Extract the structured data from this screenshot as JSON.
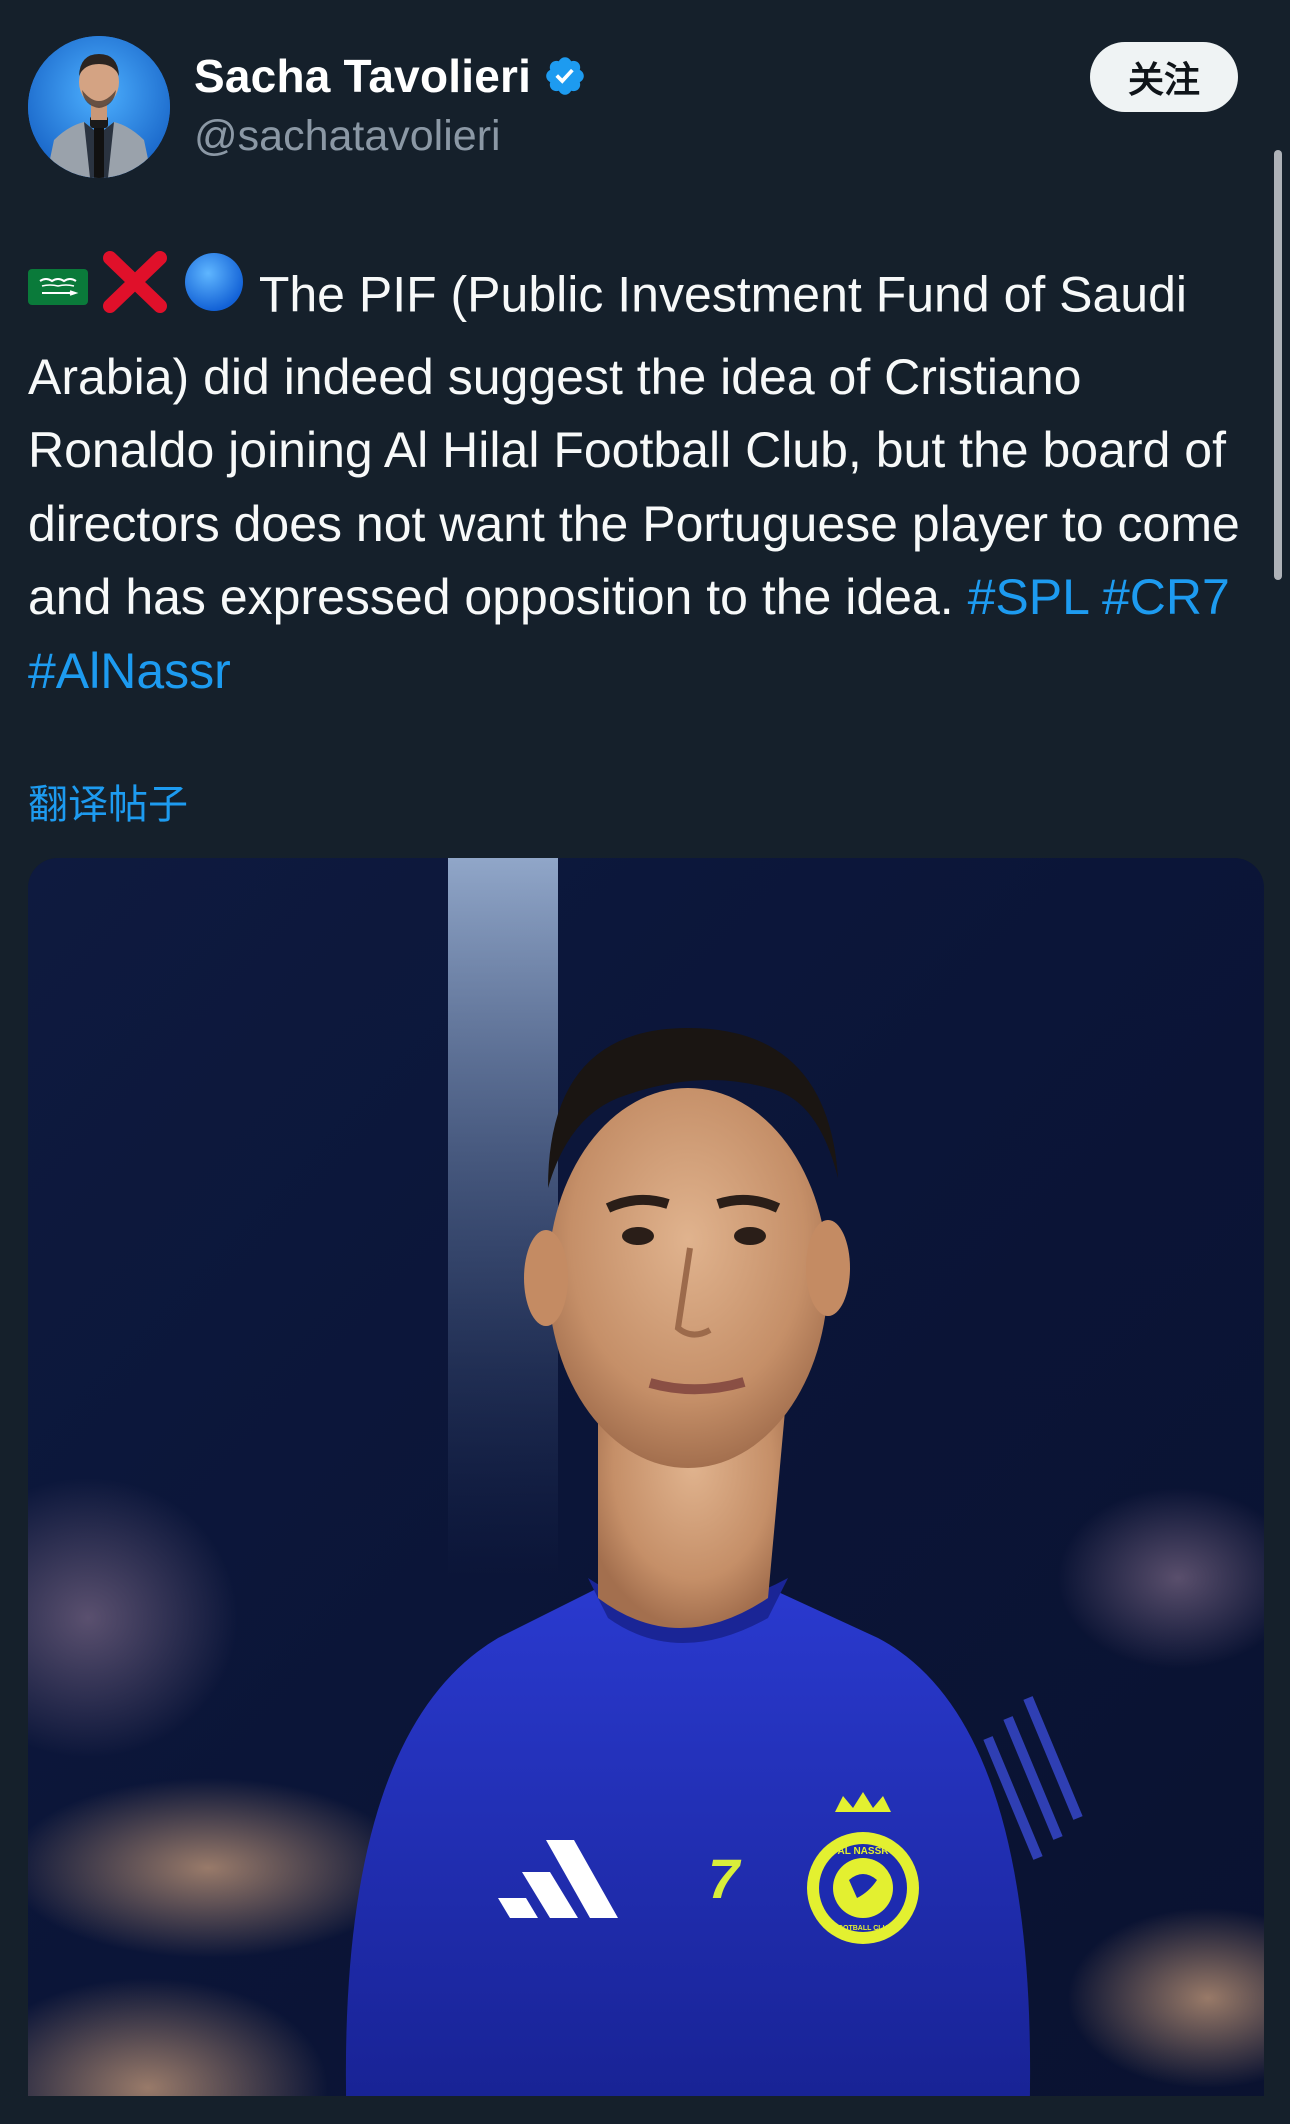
{
  "tweet": {
    "author": {
      "name": "Sacha Tavolieri",
      "handle": "@sachatavolieri",
      "verified": true
    },
    "follow_label": "关注",
    "text_lead": "The PIF (Public Investment Fund of Saudi Arabia) did indeed suggest the idea of Cristiano Ronaldo joining Al Hilal Football Club, but the board of directors does not want the Portuguese player to come and has expressed opposition to the idea.",
    "emojis": [
      "saudi-flag-icon",
      "cross-mark-icon",
      "blue-circle-icon"
    ],
    "hashtags": [
      "#SPL",
      "#CR7",
      "#AlNassr"
    ],
    "translate_label": "翻译帖子",
    "media": {
      "jersey_number": "7",
      "crest_text": "AL NASSR",
      "crest_subtext": "FOOTBALL CLUB"
    }
  },
  "colors": {
    "background": "#15202b",
    "link": "#1d9bf0",
    "handle": "#8b98a5",
    "verified": "#1d9bf0",
    "jersey": "#1f2fb8"
  }
}
